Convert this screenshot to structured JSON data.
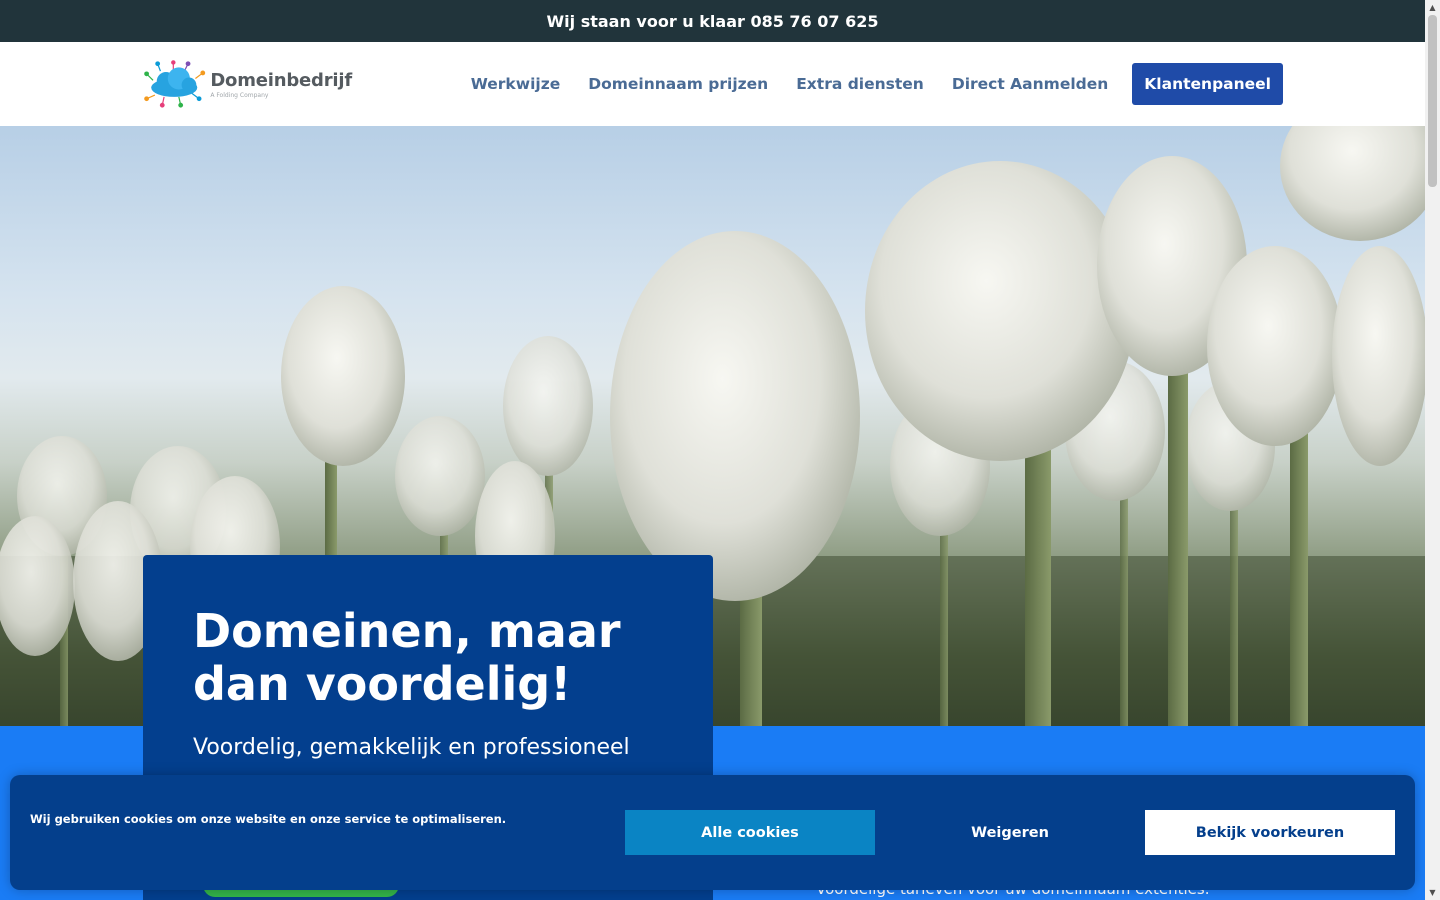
{
  "topbar": {
    "text": "Wij staan voor u klaar 085 76 07 625"
  },
  "header": {
    "logo": {
      "name": "Domeinbedrijf",
      "tagline": "A Folding Company"
    },
    "nav": [
      {
        "label": "Werkwijze"
      },
      {
        "label": "Domeinnaam prijzen"
      },
      {
        "label": "Extra diensten"
      },
      {
        "label": "Direct Aanmelden"
      }
    ],
    "cta_label": "Klantenpaneel"
  },
  "hero": {
    "title": "Domeinen, maar dan voordelig!",
    "subtitle": "Voordelig, gemakkelijk en professioneel"
  },
  "band": {
    "text": "Voordelige tarieven voor uw domeinnaam extenties."
  },
  "cookie_banner": {
    "message": "Wij gebruiken cookies om onze website en onze service te optimaliseren.",
    "accept_label": "Alle cookies",
    "deny_label": "Weigeren",
    "preferences_label": "Bekijk voorkeuren"
  },
  "colors": {
    "topbar_bg": "#21343b",
    "nav_text": "#4a6b95",
    "cta_bg": "#1f4ba8",
    "hero_box_bg": "#033f8e",
    "band_bg": "#1a7cf5",
    "cookie_bg": "#043f8c",
    "accept_bg": "#0a84c4"
  }
}
